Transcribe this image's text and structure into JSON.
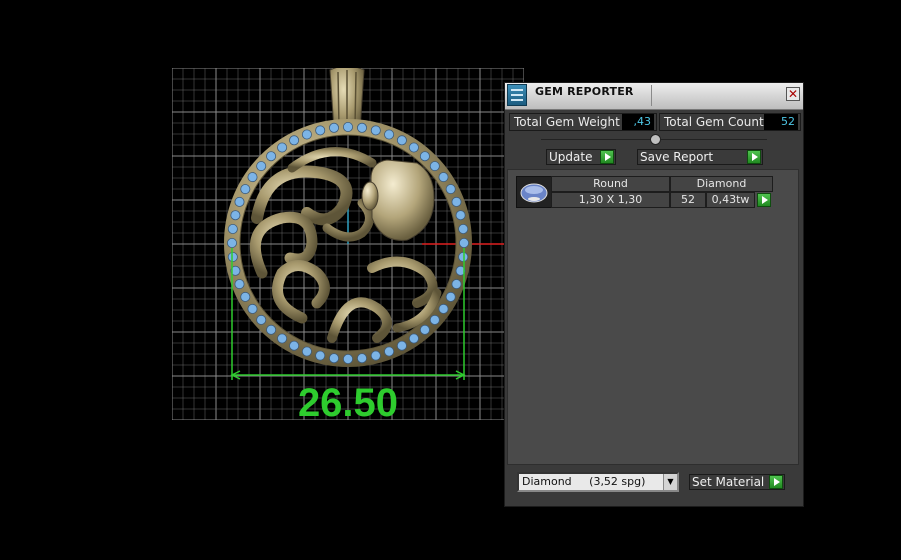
{
  "viewport": {
    "dimension_label": "26.50",
    "colors": {
      "grid": "#6a6a6a",
      "metal": "#a89a6e",
      "gems": "#7cb4e6",
      "dimension": "#2ecc2e"
    }
  },
  "panel": {
    "title": "GEM REPORTER",
    "close_icon": "close-icon",
    "total_gem_weight_label": "Total Gem Weight",
    "total_gem_weight_value": ",43",
    "total_gem_count_label": "Total Gem Count",
    "total_gem_count_value": "52",
    "update_label": "Update",
    "save_report_label": "Save Report",
    "table": {
      "headers": [
        "Round",
        "Diamond"
      ],
      "rows": [
        {
          "size": "1,30 X 1,30",
          "count": "52",
          "weight": "0,43tw"
        }
      ]
    },
    "material_select": "Diamond     (3,52 spg)",
    "set_material_label": "Set Material"
  }
}
